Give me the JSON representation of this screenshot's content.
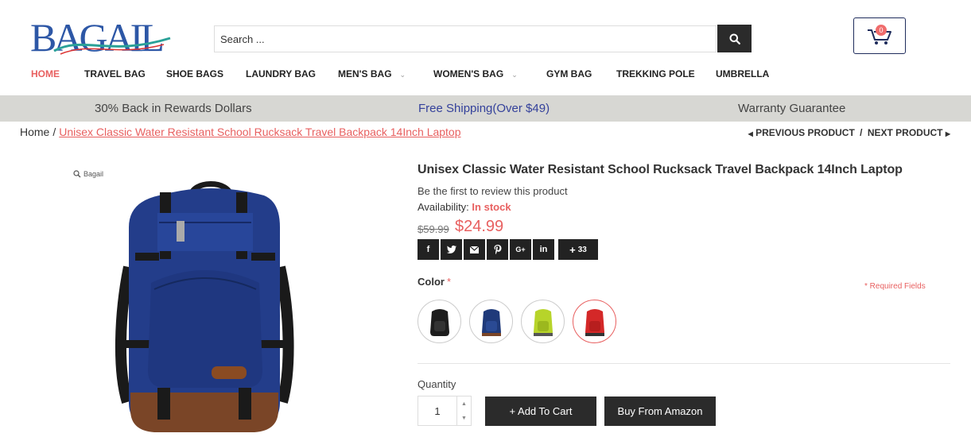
{
  "header": {
    "logo_text": "BAGAIL",
    "search": {
      "placeholder": "Search ...",
      "button_icon": "search-icon"
    },
    "cart": {
      "icon": "cart-icon",
      "count": "0"
    }
  },
  "nav": {
    "items": [
      {
        "label": "HOME",
        "active": true
      },
      {
        "label": "TRAVEL BAG"
      },
      {
        "label": "SHOE BAGS"
      },
      {
        "label": "LAUNDRY BAG"
      },
      {
        "label": "MEN'S BAG",
        "dropdown": true
      },
      {
        "label": "WOMEN'S BAG",
        "dropdown": true
      },
      {
        "label": "GYM BAG"
      },
      {
        "label": "TREKKING POLE"
      },
      {
        "label": "UMBRELLA"
      }
    ]
  },
  "promo": {
    "rewards": "30% Back in Rewards Dollars",
    "shipping": "Free Shipping(Over $49)",
    "warranty": "Warranty Guarantee"
  },
  "breadcrumb": {
    "home": "Home",
    "separator": "/",
    "current": "Unisex Classic Water Resistant School Rucksack Travel Backpack 14Inch Laptop"
  },
  "pager": {
    "previous": "PREVIOUS PRODUCT",
    "separator": "/",
    "next": "NEXT PRODUCT"
  },
  "gallery": {
    "zoom_label": "Bagail"
  },
  "product": {
    "title": "Unisex Classic Water Resistant School Rucksack Travel Backpack 14Inch Laptop",
    "review_text": "Be the first to review this product",
    "availability_label": "Availability:",
    "availability_value": "In stock",
    "old_price": "$59.99",
    "price": "$24.99",
    "share": {
      "facebook": "f",
      "twitter": "twitter-icon",
      "email": "email-icon",
      "pinterest": "pinterest-icon",
      "gplus": "G+",
      "linkedin": "in",
      "more_count": "33"
    },
    "color_label": "Color",
    "required_star": "*",
    "required_note": "* Required Fields",
    "colors": [
      {
        "name": "black",
        "hex": "#1d1d1d"
      },
      {
        "name": "navy",
        "hex": "#1f3a7a"
      },
      {
        "name": "lime",
        "hex": "#b7d42a"
      },
      {
        "name": "red",
        "hex": "#d42828",
        "selected": true
      }
    ],
    "quantity_label": "Quantity",
    "quantity_value": "1",
    "add_to_cart": "+ Add To Cart",
    "buy_amazon": "Buy From Amazon"
  },
  "colors": {
    "accent": "#e86060",
    "dark_button": "#2b2b2b",
    "promo_bg": "#d7d7d3",
    "shipping_text": "#34419b"
  }
}
